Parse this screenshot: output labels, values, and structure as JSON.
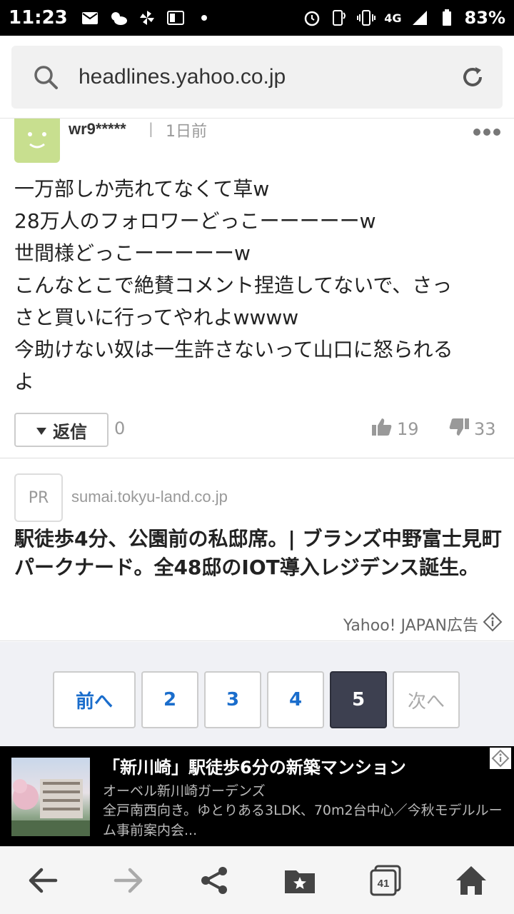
{
  "status_bar": {
    "time": "11:23",
    "network": "4G",
    "battery": "83%"
  },
  "browser": {
    "url": "headlines.yahoo.co.jp"
  },
  "comment": {
    "username": "wr9*****",
    "separator": "|",
    "time_ago": "1日前",
    "lines": [
      "一万部しか売れてなくて草w",
      "28万人のフォロワーどっこーーーーーw",
      "世間様どっこーーーーーw",
      "こんなとこで絶賛コメント捏造してないで、さっ",
      "さと買いに行ってやれよwwww",
      "今助けない奴は一生許さないって山口に怒られる",
      "よ"
    ],
    "reply_label": "返信",
    "reply_count": "0",
    "likes": "19",
    "dislikes": "33"
  },
  "ad": {
    "pr_label": "PR",
    "domain": "sumai.tokyu-land.co.jp",
    "title": "駅徒歩4分、公園前の私邸席。| ブランズ中野富士見町パークナード。全48邸のIOT導入レジデンス誕生。",
    "footer": "Yahoo! JAPAN広告"
  },
  "pagination": {
    "prev": "前へ",
    "pages": [
      "2",
      "3",
      "4",
      "5"
    ],
    "current": "5",
    "next": "次へ"
  },
  "bottom_ad": {
    "title": "「新川崎」駅徒歩6分の新築マンション",
    "subtitle": "オーベル新川崎ガーデンズ",
    "description": "全戸南西向き。ゆとりある3LDK、70m2台中心／今秋モデルルーム事前案内会..."
  },
  "navbar": {
    "tabs_count": "41"
  },
  "colors": {
    "link_blue": "#1a6dcc",
    "current_page_bg": "#3d4050",
    "avatar_green": "#c8df8f"
  }
}
